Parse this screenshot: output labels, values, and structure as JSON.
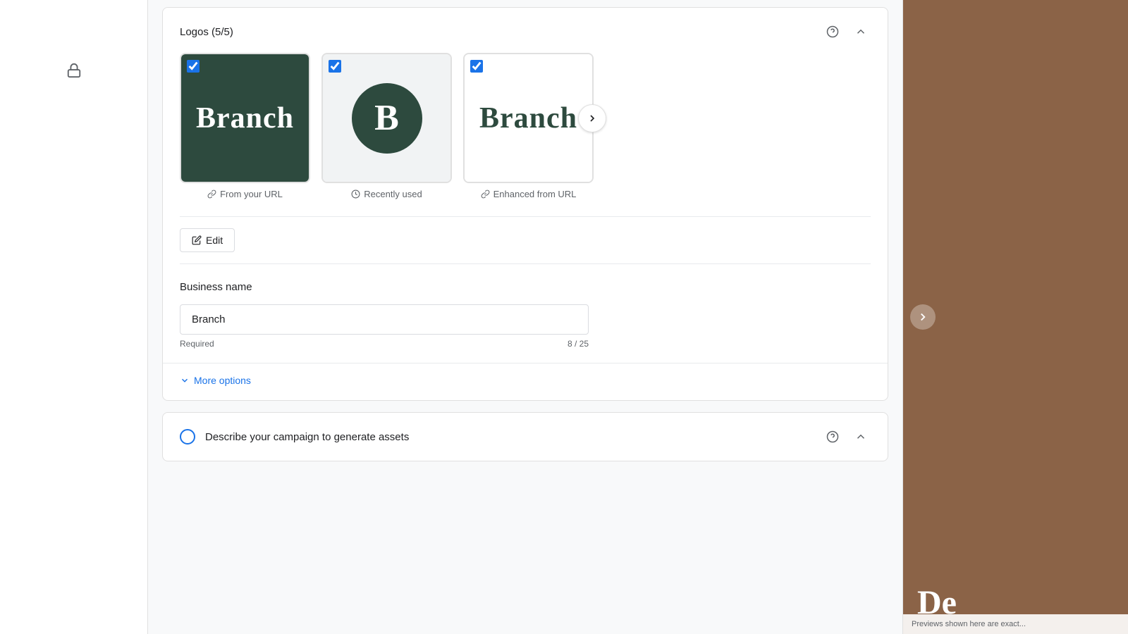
{
  "sidebar": {
    "lock_icon": "🔒"
  },
  "logos_section": {
    "title": "Logos (5/5)",
    "help_icon": "?",
    "collapse_icon": "∧",
    "cards": [
      {
        "id": "logo-dark",
        "type": "dark",
        "checked": true,
        "label": "From your URL",
        "text": "Branch"
      },
      {
        "id": "logo-circle",
        "type": "circle",
        "checked": true,
        "label": "Recently used",
        "letter": "B"
      },
      {
        "id": "logo-light",
        "type": "light",
        "checked": true,
        "label": "Enhanced from URL",
        "text": "Branch"
      }
    ],
    "next_arrow": "›"
  },
  "edit_section": {
    "edit_label": "Edit",
    "edit_icon": "✏"
  },
  "business_name_section": {
    "label": "Business name",
    "value": "Branch",
    "placeholder": "Branch",
    "required_text": "Required",
    "char_count": "8 / 25"
  },
  "more_options_section": {
    "label": "More options",
    "chevron": "∨"
  },
  "describe_section": {
    "title": "Describe your campaign to generate assets",
    "help_icon": "?",
    "collapse_icon": "∧"
  },
  "preview_panel": {
    "arrow": "›",
    "text": "De",
    "footnote": "Previews shown here are exact..."
  }
}
